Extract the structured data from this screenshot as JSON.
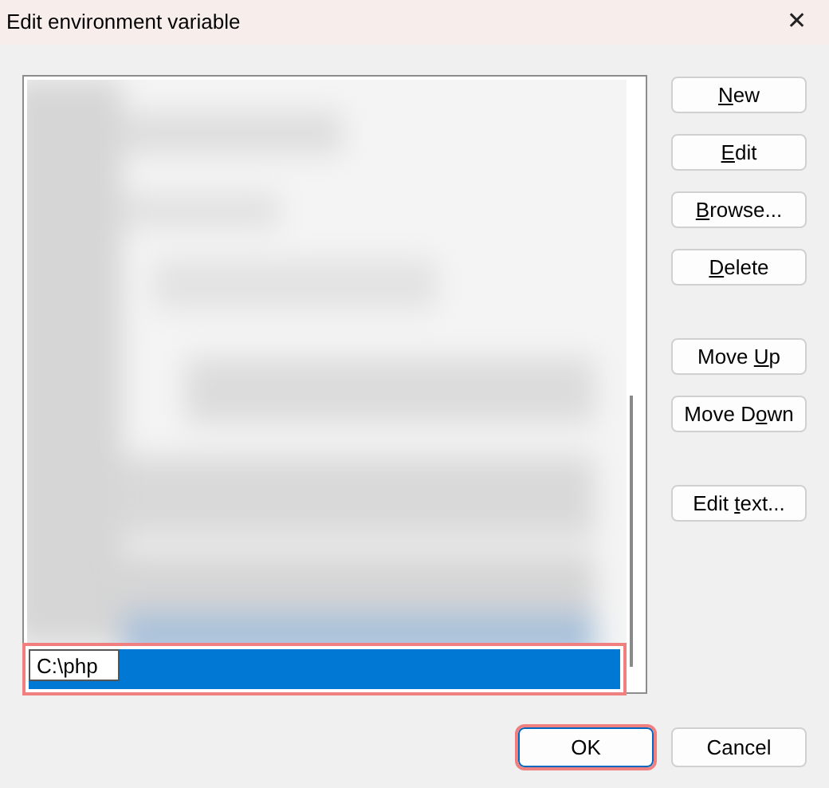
{
  "window": {
    "title": "Edit environment variable",
    "close": "✕"
  },
  "list": {
    "editing_row": {
      "value": "C:\\php",
      "selected": true,
      "highlighted": true
    }
  },
  "side_buttons": [
    {
      "key": "N",
      "after": "ew"
    },
    {
      "key": "E",
      "after": "dit"
    },
    {
      "key": "B",
      "after": "rowse..."
    },
    {
      "key": "D",
      "after": "elete"
    },
    {
      "before": "Move ",
      "key": "U",
      "after": "p"
    },
    {
      "before": "Move D",
      "key": "o",
      "after": "wn"
    },
    {
      "before": "Edit ",
      "key": "t",
      "after": "ext..."
    }
  ],
  "footer_buttons": [
    {
      "label": "OK",
      "default": true,
      "highlighted": true
    },
    {
      "label": "Cancel",
      "default": false,
      "highlighted": false
    }
  ]
}
